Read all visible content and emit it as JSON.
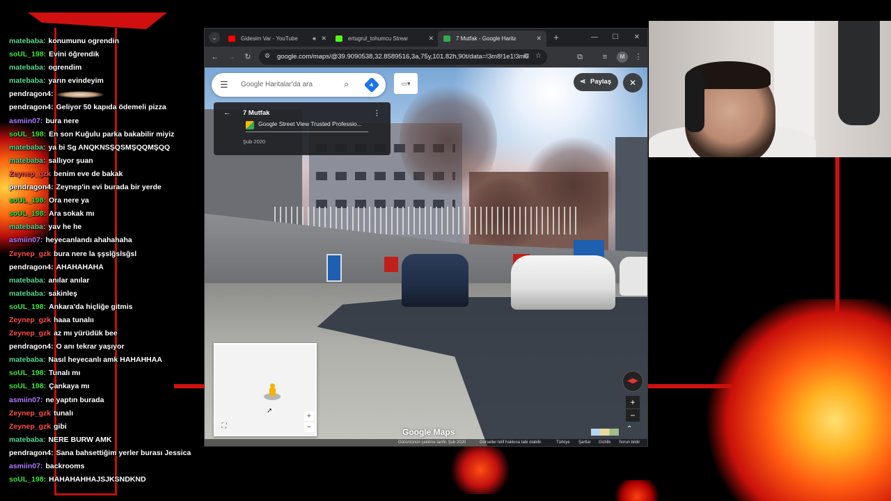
{
  "chat": {
    "messages": [
      {
        "user": "matebaba:",
        "text": "konumunu ogrendin",
        "color": "#58d68d"
      },
      {
        "user": "soUL_198:",
        "text": "Evini öğrendik",
        "color": "#39e639"
      },
      {
        "user": "matebaba:",
        "text": "ogrendim",
        "color": "#58d68d"
      },
      {
        "user": "matebaba:",
        "text": "yarın evindeyim",
        "color": "#58d68d"
      },
      {
        "user": "pendragon4:",
        "text": "",
        "color": "#ffffff"
      },
      {
        "user": "pendragon4:",
        "text": "Geliyor 50 kapıda ödemeli pizza",
        "color": "#ffffff"
      },
      {
        "user": "asmiin07:",
        "text": "bura nere",
        "color": "#b07bff"
      },
      {
        "user": "soUL_198:",
        "text": "En son Kuğulu parka bakabilir miyiz",
        "color": "#39e639"
      },
      {
        "user": "matebaba:",
        "text": "ya bi Sg ANQKNSŞQSMŞQQMŞQQ",
        "color": "#58d68d"
      },
      {
        "user": "matebaba:",
        "text": "sallıyor şuan",
        "color": "#58d68d"
      },
      {
        "user": "Zeynep_gzk",
        "text": "benim eve de bakak",
        "color": "#ff4d4d"
      },
      {
        "user": "pendragon4:",
        "text": "Zeynep'in evi burada bir yerde",
        "color": "#ffffff"
      },
      {
        "user": "soUL_198:",
        "text": "Ora nere ya",
        "color": "#39e639"
      },
      {
        "user": "soUL_198:",
        "text": "Ara sokak mı",
        "color": "#39e639"
      },
      {
        "user": "matebaba:",
        "text": "yav he he",
        "color": "#58d68d"
      },
      {
        "user": "asmiin07:",
        "text": "heyecanlandı ahahahaha",
        "color": "#b07bff"
      },
      {
        "user": "Zeynep_gzk",
        "text": "bura nere la şşslğslsğsl",
        "color": "#ff4d4d"
      },
      {
        "user": "pendragon4:",
        "text": "AHAHAHAHA",
        "color": "#ffffff"
      },
      {
        "user": "matebaba:",
        "text": "anılar anılar",
        "color": "#58d68d"
      },
      {
        "user": "matebaba:",
        "text": "sakinleş",
        "color": "#58d68d"
      },
      {
        "user": "soUL_198:",
        "text": "Ankara'da hiçliğe gitmis",
        "color": "#39e639"
      },
      {
        "user": "Zeynep_gzk",
        "text": "haaa tunalıı",
        "color": "#ff4d4d"
      },
      {
        "user": "Zeynep_gzk",
        "text": "az mı yürüdük bee",
        "color": "#ff4d4d"
      },
      {
        "user": "pendragon4:",
        "text": "O anı tekrar yaşıyor",
        "color": "#ffffff"
      },
      {
        "user": "matebaba:",
        "text": "Nasıl heyecanlı amk HAHAHHAA",
        "color": "#58d68d"
      },
      {
        "user": "soUL_198:",
        "text": "Tunalı mı",
        "color": "#39e639"
      },
      {
        "user": "soUL_198:",
        "text": "Çankaya mı",
        "color": "#39e639"
      },
      {
        "user": "asmiin07:",
        "text": "ne yaptın burada",
        "color": "#b07bff"
      },
      {
        "user": "Zeynep_gzk",
        "text": "tunalı",
        "color": "#ff4d4d"
      },
      {
        "user": "Zeynep_gzk",
        "text": "gibi",
        "color": "#ff4d4d"
      },
      {
        "user": "matebaba:",
        "text": "NERE BURW AMK",
        "color": "#58d68d"
      },
      {
        "user": "pendragon4:",
        "text": "Sana bahsettiğim yerler burası Jessica",
        "color": "#ffffff"
      },
      {
        "user": "asmiin07:",
        "text": "backrooms",
        "color": "#b07bff"
      },
      {
        "user": "soUL_198:",
        "text": "HAHAHAHHAJSJKSNDKND",
        "color": "#39e639"
      }
    ]
  },
  "browser": {
    "tabs": [
      {
        "label": "Gidesim Var - YouTube",
        "favicon_color": "#ff0000",
        "active": false,
        "audio": true
      },
      {
        "label": "ertugrul_tohumcu Stream - W",
        "favicon_color": "#53fc18",
        "active": false,
        "audio": false
      },
      {
        "label": "7 Mutfak - Google Haritalar",
        "favicon_color": "#34a853",
        "active": true,
        "audio": false
      }
    ],
    "url": "google.com/maps/@39.9090538,32.8589516,3a,75y,101.82h,90t/data=!3m8!1e1!3m6!1...",
    "profile_initial": "M"
  },
  "maps": {
    "search_placeholder": "Google Haritalar'da ara",
    "place_title": "7 Mutfak",
    "place_author": "Google Street View Trusted Professio...",
    "place_date": "Şub 2020",
    "share_label": "Paylaş",
    "logo_text": "Google Maps",
    "footer": {
      "capture_date": "Görüntünün çekilme tarihi: Şub 2020",
      "copyright": "Görseller telif hakkına tabi olabilir.",
      "region": "Türkiye",
      "terms": "Şartlar",
      "privacy": "Gizlilik",
      "report": "Sorun bildir"
    }
  }
}
